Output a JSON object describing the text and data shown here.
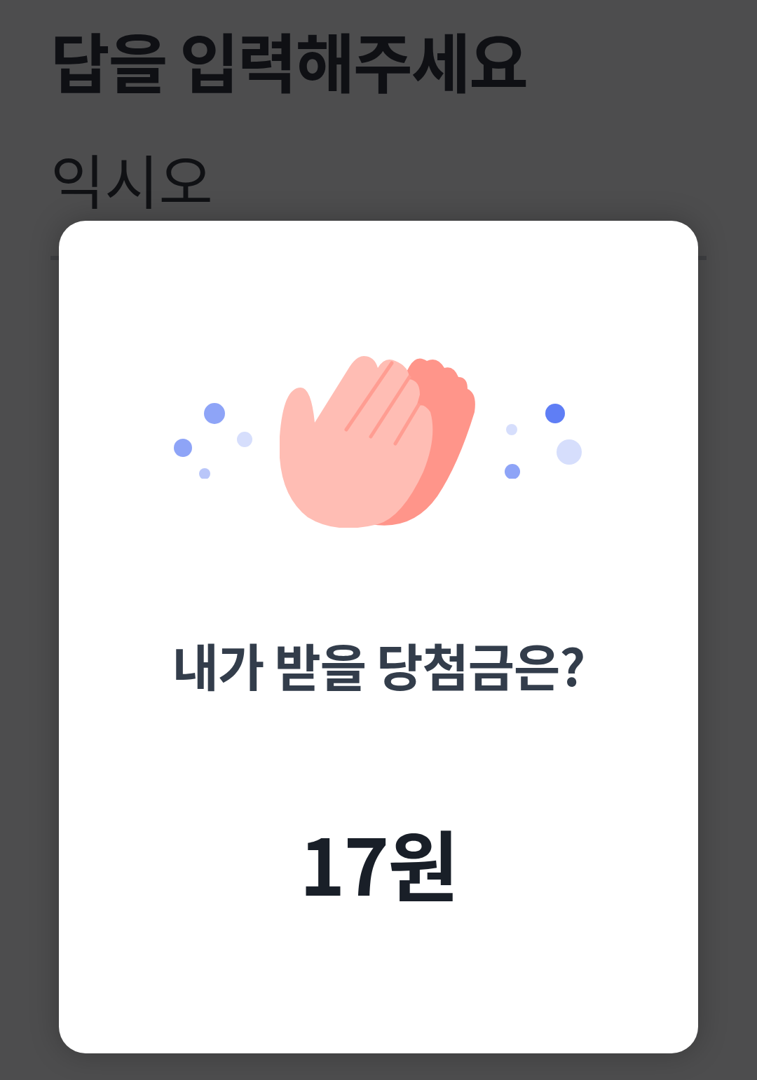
{
  "page": {
    "title": "답을 입력해주세요",
    "answer_field": {
      "value": "익시오"
    }
  },
  "modal": {
    "illustration": {
      "kind": "clapping-hands"
    },
    "question": "내가 받을 당첨금은?",
    "prize": "17원"
  }
}
